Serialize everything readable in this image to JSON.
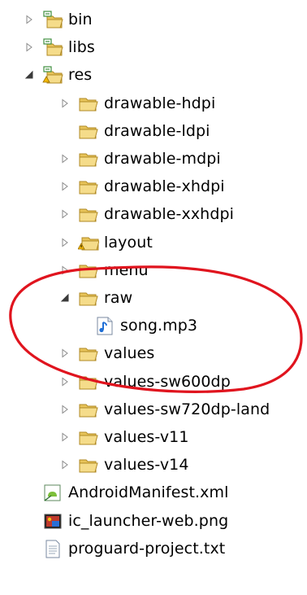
{
  "tree": {
    "rows": [
      {
        "label": "bin",
        "twisty": "collapsed",
        "icon": "folder-package-icon",
        "depth": 0
      },
      {
        "label": "libs",
        "twisty": "collapsed",
        "icon": "folder-package-icon",
        "depth": 0
      },
      {
        "label": "res",
        "twisty": "expanded",
        "icon": "folder-package-warning-icon",
        "depth": 0
      },
      {
        "label": "drawable-hdpi",
        "twisty": "collapsed",
        "icon": "folder-icon",
        "depth": 1
      },
      {
        "label": "drawable-ldpi",
        "twisty": "none",
        "icon": "folder-icon",
        "depth": 1
      },
      {
        "label": "drawable-mdpi",
        "twisty": "collapsed",
        "icon": "folder-icon",
        "depth": 1
      },
      {
        "label": "drawable-xhdpi",
        "twisty": "collapsed",
        "icon": "folder-icon",
        "depth": 1
      },
      {
        "label": "drawable-xxhdpi",
        "twisty": "collapsed",
        "icon": "folder-icon",
        "depth": 1
      },
      {
        "label": "layout",
        "twisty": "collapsed",
        "icon": "folder-warning-icon",
        "depth": 1
      },
      {
        "label": "menu",
        "twisty": "collapsed",
        "icon": "folder-icon",
        "depth": 1
      },
      {
        "label": "raw",
        "twisty": "expanded",
        "icon": "folder-icon",
        "depth": 1
      },
      {
        "label": "song.mp3",
        "twisty": "none",
        "icon": "audio-file-icon",
        "depth": 2
      },
      {
        "label": "values",
        "twisty": "collapsed",
        "icon": "folder-icon",
        "depth": 1
      },
      {
        "label": "values-sw600dp",
        "twisty": "collapsed",
        "icon": "folder-icon",
        "depth": 1
      },
      {
        "label": "values-sw720dp-land",
        "twisty": "collapsed",
        "icon": "folder-icon",
        "depth": 1
      },
      {
        "label": "values-v11",
        "twisty": "collapsed",
        "icon": "folder-icon",
        "depth": 1
      },
      {
        "label": "values-v14",
        "twisty": "collapsed",
        "icon": "folder-icon",
        "depth": 1
      },
      {
        "label": "AndroidManifest.xml",
        "twisty": "none",
        "icon": "android-manifest-icon",
        "depth": 0
      },
      {
        "label": "ic_launcher-web.png",
        "twisty": "none",
        "icon": "image-file-icon",
        "depth": 0
      },
      {
        "label": "proguard-project.txt",
        "twisty": "none",
        "icon": "text-file-icon",
        "depth": 0
      }
    ]
  },
  "annotation": {
    "shape": "red-ellipse-icon",
    "color": "#e0141e",
    "encloses": "raw"
  }
}
